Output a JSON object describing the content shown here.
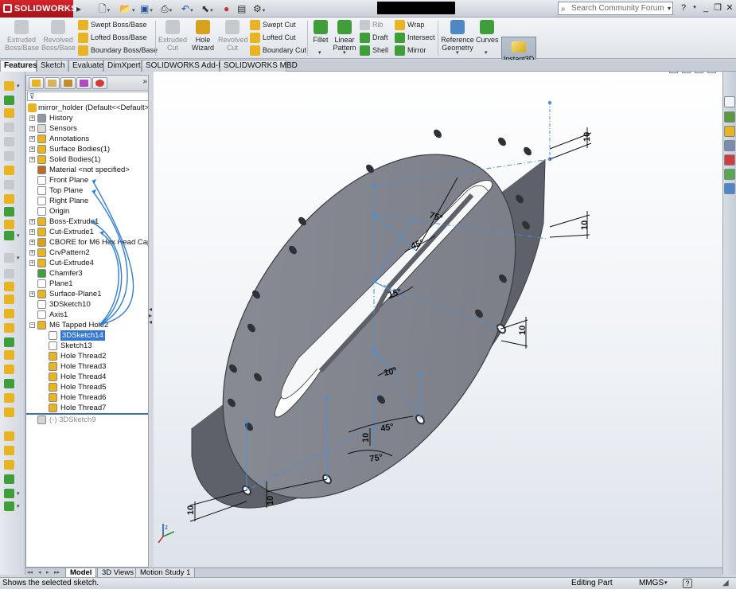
{
  "app": {
    "name": "SOLIDWORKS"
  },
  "search": {
    "placeholder": "Search Community Forum"
  },
  "ribbon": {
    "extruded_boss": "Extruded Boss/Base",
    "revolved_boss": "Revolved Boss/Base",
    "swept_boss": "Swept Boss/Base",
    "lofted_boss": "Lofted Boss/Base",
    "boundary_boss": "Boundary Boss/Base",
    "extruded_cut": "Extruded Cut",
    "hole_wizard": "Hole Wizard",
    "revolved_cut": "Revolved Cut",
    "swept_cut": "Swept Cut",
    "lofted_cut": "Lofted Cut",
    "boundary_cut": "Boundary Cut",
    "fillet": "Fillet",
    "linear_pattern": "Linear Pattern",
    "rib": "Rib",
    "draft": "Draft",
    "shell": "Shell",
    "wrap": "Wrap",
    "intersect": "Intersect",
    "mirror": "Mirror",
    "reference_geometry": "Reference Geometry",
    "curves": "Curves",
    "instant3d": "Instant3D"
  },
  "command_tabs": [
    "Features",
    "Sketch",
    "Evaluate",
    "DimXpert",
    "SOLIDWORKS Add-Ins",
    "SOLIDWORKS MBD"
  ],
  "tree": {
    "root": "mirror_holder  (Default<<Default>_Display State 1>)",
    "items": [
      "History",
      "Sensors",
      "Annotations",
      "Surface Bodies(1)",
      "Solid Bodies(1)",
      "Material <not specified>",
      "Front Plane",
      "Top Plane",
      "Right Plane",
      "Origin",
      "Boss-Extrude1",
      "Cut-Extrude1",
      "CBORE for M6 Hex Head Cap Screw1",
      "CrvPattern2",
      "Cut-Extrude4",
      "Chamfer3",
      "Plane1",
      "Surface-Plane1",
      "3DSketch10",
      "Axis1",
      "M6 Tapped Hole2",
      "3DSketch14",
      "Sketch13",
      "Hole Thread2",
      "Hole Thread3",
      "Hole Thread4",
      "Hole Thread5",
      "Hole Thread6",
      "Hole Thread7",
      "(-) 3DSketch9"
    ]
  },
  "dimensions": {
    "d_top_right": "10",
    "d_right_mid": "10",
    "d_right_low": "10",
    "d_bottom_left_v": "10",
    "d_bottom_left_h": "10",
    "d_bottom_mid": "10",
    "a_75_top": "75°",
    "a_45_top": "45°",
    "a_15": "15°",
    "a_10": "10°",
    "a_45_bottom": "45°",
    "a_75_bottom": "75°"
  },
  "bottom_tabs": [
    "Model",
    "3D Views",
    "Motion Study 1"
  ],
  "status": {
    "message": "Shows the selected sketch.",
    "mode": "Editing Part",
    "units": "MMGS"
  },
  "colors": {
    "part": "#7f828b",
    "sketch": "#4a90d9",
    "selection": "#3477d5"
  }
}
